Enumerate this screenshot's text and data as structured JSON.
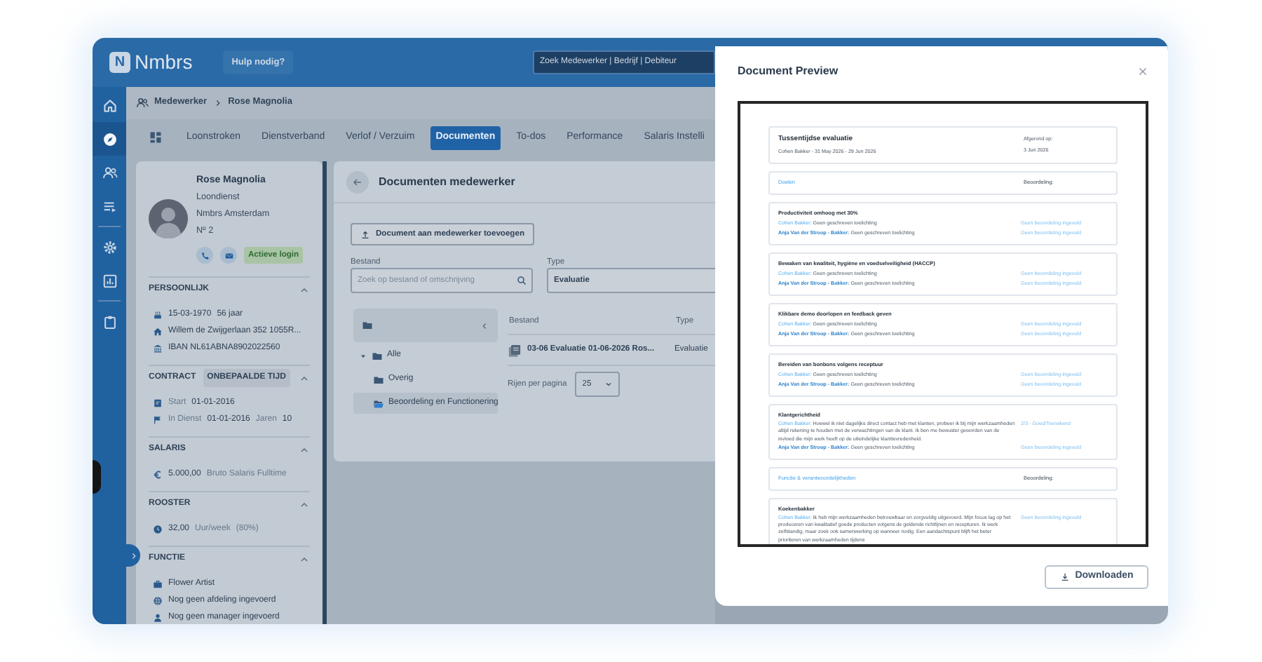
{
  "topbar": {
    "logo_badge": "N",
    "logo": "Nmbrs",
    "help_button": "Hulp nodig?",
    "search": "Zoek Medewerker | Bedrijf | Debiteur"
  },
  "nav_groups": [
    [
      {
        "kind": "home",
        "selected": false
      },
      {
        "kind": "compass",
        "selected": true
      },
      {
        "kind": "people",
        "selected": false
      },
      {
        "kind": "list",
        "selected": false
      }
    ],
    [
      {
        "kind": "gear",
        "selected": false
      },
      {
        "kind": "chart",
        "selected": false
      }
    ],
    [
      {
        "kind": "clipboard",
        "selected": false
      }
    ]
  ],
  "breadcrumb": [
    "Medewerker",
    "Rose Magnolia"
  ],
  "tabs": [
    {
      "label": "Loonstroken",
      "selected": false
    },
    {
      "label": "Dienstverband",
      "selected": false
    },
    {
      "label": "Verlof / Verzuim",
      "selected": false
    },
    {
      "label": "Documenten",
      "selected": true
    },
    {
      "label": "To-dos",
      "selected": false
    },
    {
      "label": "Performance",
      "selected": false
    },
    {
      "label": "Salaris Instelli",
      "selected": false
    }
  ],
  "profile": {
    "name": "Rose Magnolia",
    "details": [
      "Loondienst",
      "Nmbrs Amsterdam",
      "Nº 2"
    ],
    "status_badge": "Actieve login"
  },
  "sections": [
    {
      "title": "PERSOONLIJK",
      "expanded": true,
      "rows": [
        {
          "kind": "cake",
          "parts": [
            {
              "text": "15-03-1970",
              "muted": false
            },
            {
              "text": "56 jaar",
              "muted": false
            }
          ]
        },
        {
          "kind": "house",
          "parts": [
            {
              "text": "Willem de Zwijgerlaan 352 1055R...",
              "muted": false
            }
          ]
        },
        {
          "kind": "bank",
          "parts": [
            {
              "text": "IBAN NL61ABNA8902022560",
              "muted": false
            }
          ]
        }
      ]
    },
    {
      "title": "CONTRACT",
      "tag": "ONBEPAALDE TIJD",
      "expanded": true,
      "rows": [
        {
          "kind": "calendar",
          "parts": [
            {
              "text": "Start",
              "muted": true
            },
            {
              "text": "01-01-2016",
              "muted": false
            }
          ]
        },
        {
          "kind": "flag",
          "parts": [
            {
              "text": "In Dienst",
              "muted": true
            },
            {
              "text": "01-01-2016",
              "muted": false
            },
            {
              "text": "Jaren",
              "muted": true
            },
            {
              "text": "10",
              "muted": false
            }
          ]
        }
      ]
    },
    {
      "title": "SALARIS",
      "expanded": true,
      "rows": [
        {
          "kind": "euro",
          "parts": [
            {
              "text": "5.000,00",
              "muted": false
            },
            {
              "text": "Bruto Salaris Fulltime",
              "muted": true
            }
          ]
        }
      ]
    },
    {
      "title": "ROOSTER",
      "expanded": true,
      "rows": [
        {
          "kind": "clock",
          "parts": [
            {
              "text": "32,00",
              "muted": false
            },
            {
              "text": "Uur/week",
              "muted": true
            },
            {
              "text": "(80%)",
              "muted": true
            }
          ]
        }
      ]
    },
    {
      "title": "FUNCTIE",
      "expanded": true,
      "rows": [
        {
          "kind": "briefcase",
          "parts": [
            {
              "text": "Flower Artist",
              "muted": false
            }
          ]
        },
        {
          "kind": "globe",
          "parts": [
            {
              "text": "Nog geen afdeling ingevoerd",
              "muted": false
            }
          ]
        },
        {
          "kind": "person",
          "parts": [
            {
              "text": "Nog geen manager ingevoerd",
              "muted": false
            }
          ]
        }
      ]
    }
  ],
  "documents": {
    "title": "Documenten medewerker",
    "add_button": "Document aan medewerker toevoegen",
    "file_label": "Bestand",
    "file_placeholder": "Zoek op bestand of omschrijving",
    "type_label": "Type",
    "type_value": "Evaluatie",
    "folders": [
      {
        "name": "Alle",
        "expanded": true,
        "selected": false,
        "children": [
          {
            "name": "Overig",
            "selected": false
          },
          {
            "name": "Beoordeling en Functionering",
            "selected": true
          }
        ]
      }
    ],
    "columns": [
      "Bestand",
      "Type"
    ],
    "rows": [
      {
        "file": "03-06 Evaluatie 01-06-2026 Ros...",
        "type": "Evaluatie"
      }
    ],
    "rows_per_page_label": "Rijen per pagina",
    "rows_per_page": "25"
  },
  "preview": {
    "title": "Document Preview",
    "header": {
      "title": "Tussentijdse evaluatie",
      "subtitle": "Cohen Bakker - 31 May 2026 - 29 Jun 2026",
      "done_label": "Afgerond op:",
      "done_date": "3 Jun 2026"
    },
    "blocks": [
      {
        "kind": "section",
        "title": "Doelen",
        "rating_label": "Beoordeling:"
      },
      {
        "kind": "item",
        "title": "Productiviteit omhoog met 30%",
        "entries": [
          {
            "author": "Cohen Bakker:",
            "emphasis": false,
            "text": "Geen geschreven toelichting",
            "rating": "Geen beoordeling ingevuld"
          },
          {
            "author": "Anja Van der Stroop - Bakker:",
            "emphasis": true,
            "text": "Geen geschreven toelichting",
            "rating": "Geen beoordeling ingevuld"
          }
        ]
      },
      {
        "kind": "item",
        "title": "Bewaken van kwaliteit, hygiëne en voedselveiligheid (HACCP)",
        "entries": [
          {
            "author": "Cohen Bakker:",
            "emphasis": false,
            "text": "Geen geschreven toelichting",
            "rating": "Geen beoordeling ingevuld"
          },
          {
            "author": "Anja Van der Stroop - Bakker:",
            "emphasis": true,
            "text": "Geen geschreven toelichting",
            "rating": "Geen beoordeling ingevuld"
          }
        ]
      },
      {
        "kind": "item",
        "title": "Klikbare demo doorlopen en feedback geven",
        "entries": [
          {
            "author": "Cohen Bakker:",
            "emphasis": false,
            "text": "Geen geschreven toelichting",
            "rating": "Geen beoordeling ingevuld"
          },
          {
            "author": "Anja Van der Stroop - Bakker:",
            "emphasis": true,
            "text": "Geen geschreven toelichting",
            "rating": "Geen beoordeling ingevuld"
          }
        ]
      },
      {
        "kind": "item",
        "title": "Bereiden van bonbons volgens receptuur",
        "entries": [
          {
            "author": "Cohen Bakker:",
            "emphasis": false,
            "text": "Geen geschreven toelichting",
            "rating": "Geen beoordeling ingevuld"
          },
          {
            "author": "Anja Van der Stroop - Bakker:",
            "emphasis": true,
            "text": "Geen geschreven toelichting",
            "rating": "Geen beoordeling ingevuld"
          }
        ]
      },
      {
        "kind": "item",
        "title": "Klantgerichtheid",
        "entries": [
          {
            "author": "Cohen Bakker:",
            "emphasis": false,
            "text": "Hoewel ik niet dagelijks direct contact heb met klanten, probeer ik bij mijn werkzaamheden altijd rekening te houden met de verwachtingen van de klant. Ik ben me bewuster geworden van de invloed die mijn werk heeft op de uiteindelijke klanttevredenheid.",
            "rating": "2/3 - Goed/Toereikend"
          },
          {
            "author": "Anja Van der Stroop - Bakker:",
            "emphasis": true,
            "text": "Geen geschreven toelichting",
            "rating": "Geen beoordeling ingevuld"
          }
        ]
      },
      {
        "kind": "section",
        "title": "Functie & verantwoordelijkheden",
        "rating_label": "Beoordeling:"
      },
      {
        "kind": "item",
        "title": "Koekenbakker",
        "entries": [
          {
            "author": "Cohen Bakker:",
            "emphasis": false,
            "text": "Ik heb mijn werkzaamheden betrouwbaar en zorgvuldig uitgevoerd. Mijn focus lag op het produceren van kwalitatief goede producten volgens de geldende richtlijnen en recepturen. Ik werk zelfstandig, maar zoek ook samenwerking op wanneer nodig. Een aandachtspunt blijft het beter prioriteren van werkzaamheden tijdens",
            "rating": "Geen beoordeling ingevuld"
          }
        ]
      }
    ],
    "download_button": "Downloaden"
  }
}
